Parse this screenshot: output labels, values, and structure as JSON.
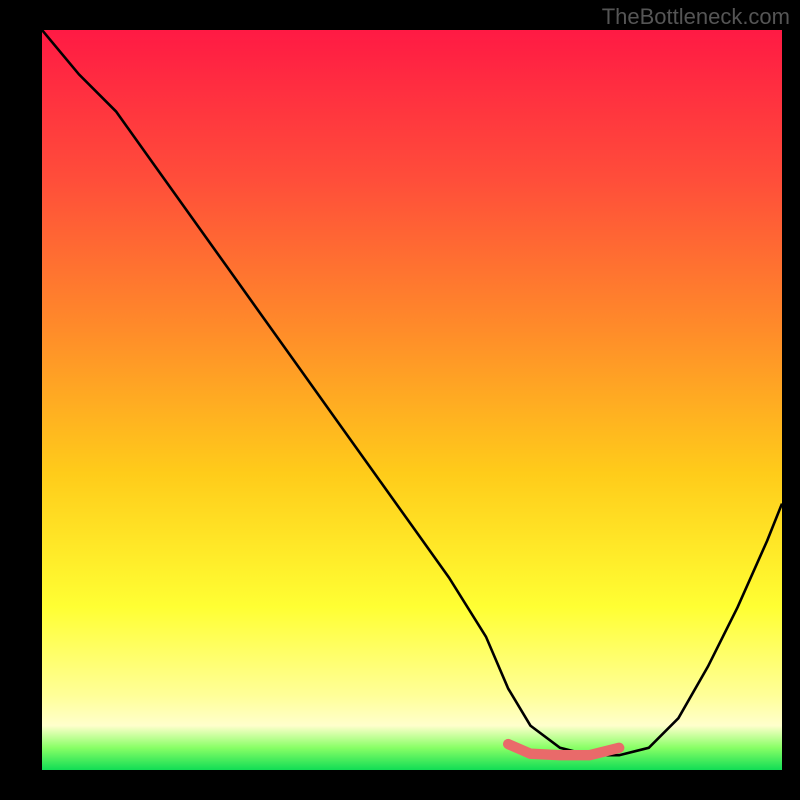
{
  "watermark": "TheBottleneck.com",
  "chart_data": {
    "type": "line",
    "title": "",
    "xlabel": "",
    "ylabel": "",
    "xlim": [
      0,
      100
    ],
    "ylim": [
      0,
      100
    ],
    "gradient_stops": [
      {
        "pos": 0.0,
        "color": "#ff1a44"
      },
      {
        "pos": 0.2,
        "color": "#ff4d3a"
      },
      {
        "pos": 0.4,
        "color": "#ff8a2a"
      },
      {
        "pos": 0.6,
        "color": "#ffcc1a"
      },
      {
        "pos": 0.78,
        "color": "#ffff33"
      },
      {
        "pos": 0.9,
        "color": "#ffff99"
      },
      {
        "pos": 0.94,
        "color": "#ffffcc"
      },
      {
        "pos": 0.97,
        "color": "#88ff66"
      },
      {
        "pos": 1.0,
        "color": "#11dd55"
      }
    ],
    "series": [
      {
        "name": "bottleneck-curve",
        "color": "#000000",
        "x": [
          0,
          5,
          10,
          15,
          20,
          25,
          30,
          35,
          40,
          45,
          50,
          55,
          60,
          63,
          66,
          70,
          74,
          78,
          82,
          86,
          90,
          94,
          98,
          100
        ],
        "y": [
          100,
          94,
          89,
          82,
          75,
          68,
          61,
          54,
          47,
          40,
          33,
          26,
          18,
          11,
          6,
          3,
          2,
          2,
          3,
          7,
          14,
          22,
          31,
          36
        ]
      },
      {
        "name": "optimal-range-marker",
        "color": "#e96a6a",
        "x": [
          63,
          66,
          70,
          74,
          78
        ],
        "y": [
          3.5,
          2.2,
          2.0,
          2.0,
          3.0
        ]
      }
    ],
    "optimal_range": {
      "start_x": 63,
      "end_x": 78
    }
  }
}
